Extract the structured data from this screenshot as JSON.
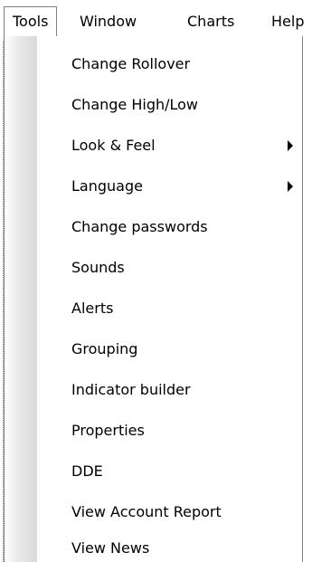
{
  "menubar": {
    "items": [
      {
        "label": "Tools",
        "active": true
      },
      {
        "label": "Window"
      },
      {
        "label": "Charts"
      },
      {
        "label": "Help"
      }
    ]
  },
  "tools_menu": {
    "items": [
      {
        "label": "Change Rollover"
      },
      {
        "label": "Change High/Low"
      },
      {
        "label": "Look & Feel",
        "has_submenu": true
      },
      {
        "label": "Language",
        "has_submenu": true
      },
      {
        "label": "Change passwords"
      },
      {
        "label": "Sounds"
      },
      {
        "label": "Alerts"
      },
      {
        "label": "Grouping"
      },
      {
        "label": "Indicator builder"
      },
      {
        "label": "Properties"
      },
      {
        "label": "DDE"
      },
      {
        "label": "View Account Report"
      },
      {
        "label": "View News"
      }
    ]
  },
  "icons": {
    "submenu_arrow": "chevron-right-icon"
  }
}
